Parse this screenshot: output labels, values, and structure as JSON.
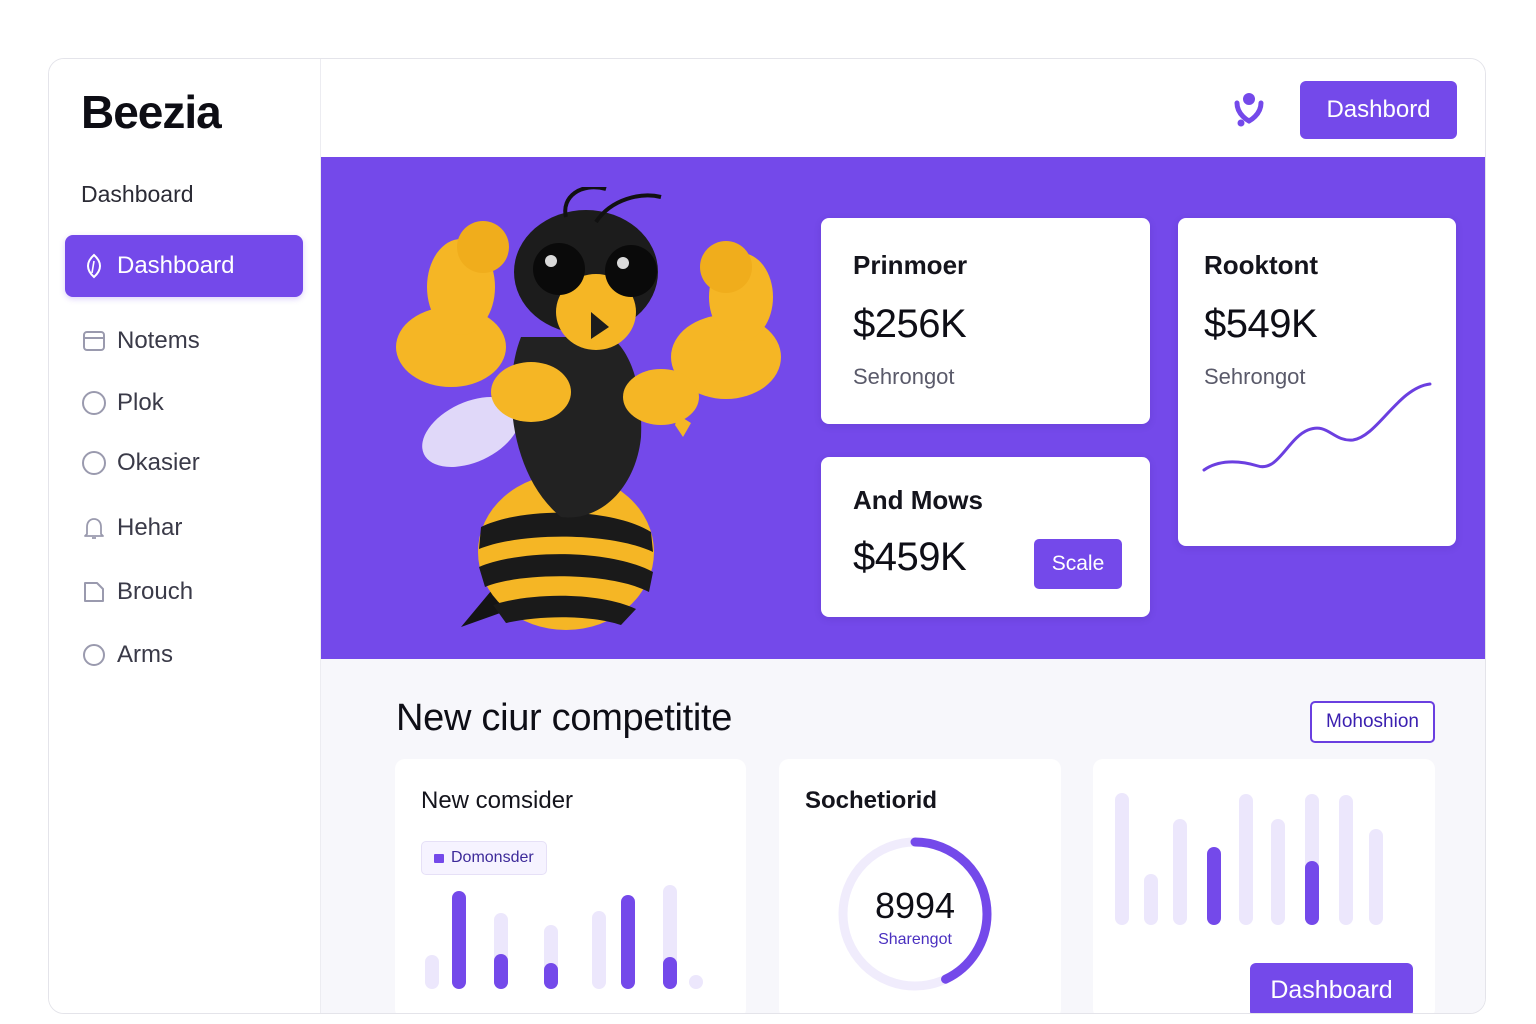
{
  "app": {
    "logo": "Beezia"
  },
  "sidebar": {
    "heading": "Dashboard",
    "items": [
      {
        "label": "Dashboard",
        "icon": "leaf-icon",
        "active": true
      },
      {
        "label": "Notems",
        "icon": "calendar-icon"
      },
      {
        "label": "Plok",
        "icon": "circle-icon"
      },
      {
        "label": "Okasier",
        "icon": "circle-icon"
      },
      {
        "label": "Hehar",
        "icon": "bell-icon"
      },
      {
        "label": "Brouch",
        "icon": "document-icon"
      },
      {
        "label": "Arms",
        "icon": "circle-icon"
      }
    ]
  },
  "topbar": {
    "icon": "location-person-icon",
    "button_label": "Dashbord"
  },
  "hero": {
    "mascot": "muscular-bee-mascot",
    "cards": {
      "primary": {
        "title": "Prinmoer",
        "value": "$256K",
        "sub": "Sehrongot"
      },
      "secondary": {
        "title": "And Mows",
        "value": "$459K",
        "button_label": "Scale"
      },
      "trend": {
        "title": "Rooktont",
        "value": "$549K",
        "sub": "Sehrongot"
      }
    }
  },
  "lower": {
    "title": "New ciur competitite",
    "button_label": "Mohoshion",
    "panel_left": {
      "title": "New comsider",
      "chip_label": "Domonsder"
    },
    "panel_mid": {
      "title": "Sochetiorid",
      "value": "8994",
      "sub": "Sharengot",
      "progress_fraction": 0.43
    },
    "panel_right": {
      "button_label": "Dashboard"
    }
  },
  "colors": {
    "accent": "#7449ea",
    "accent_light": "#ece7fc",
    "panel_bg": "#f7f7fb"
  }
}
